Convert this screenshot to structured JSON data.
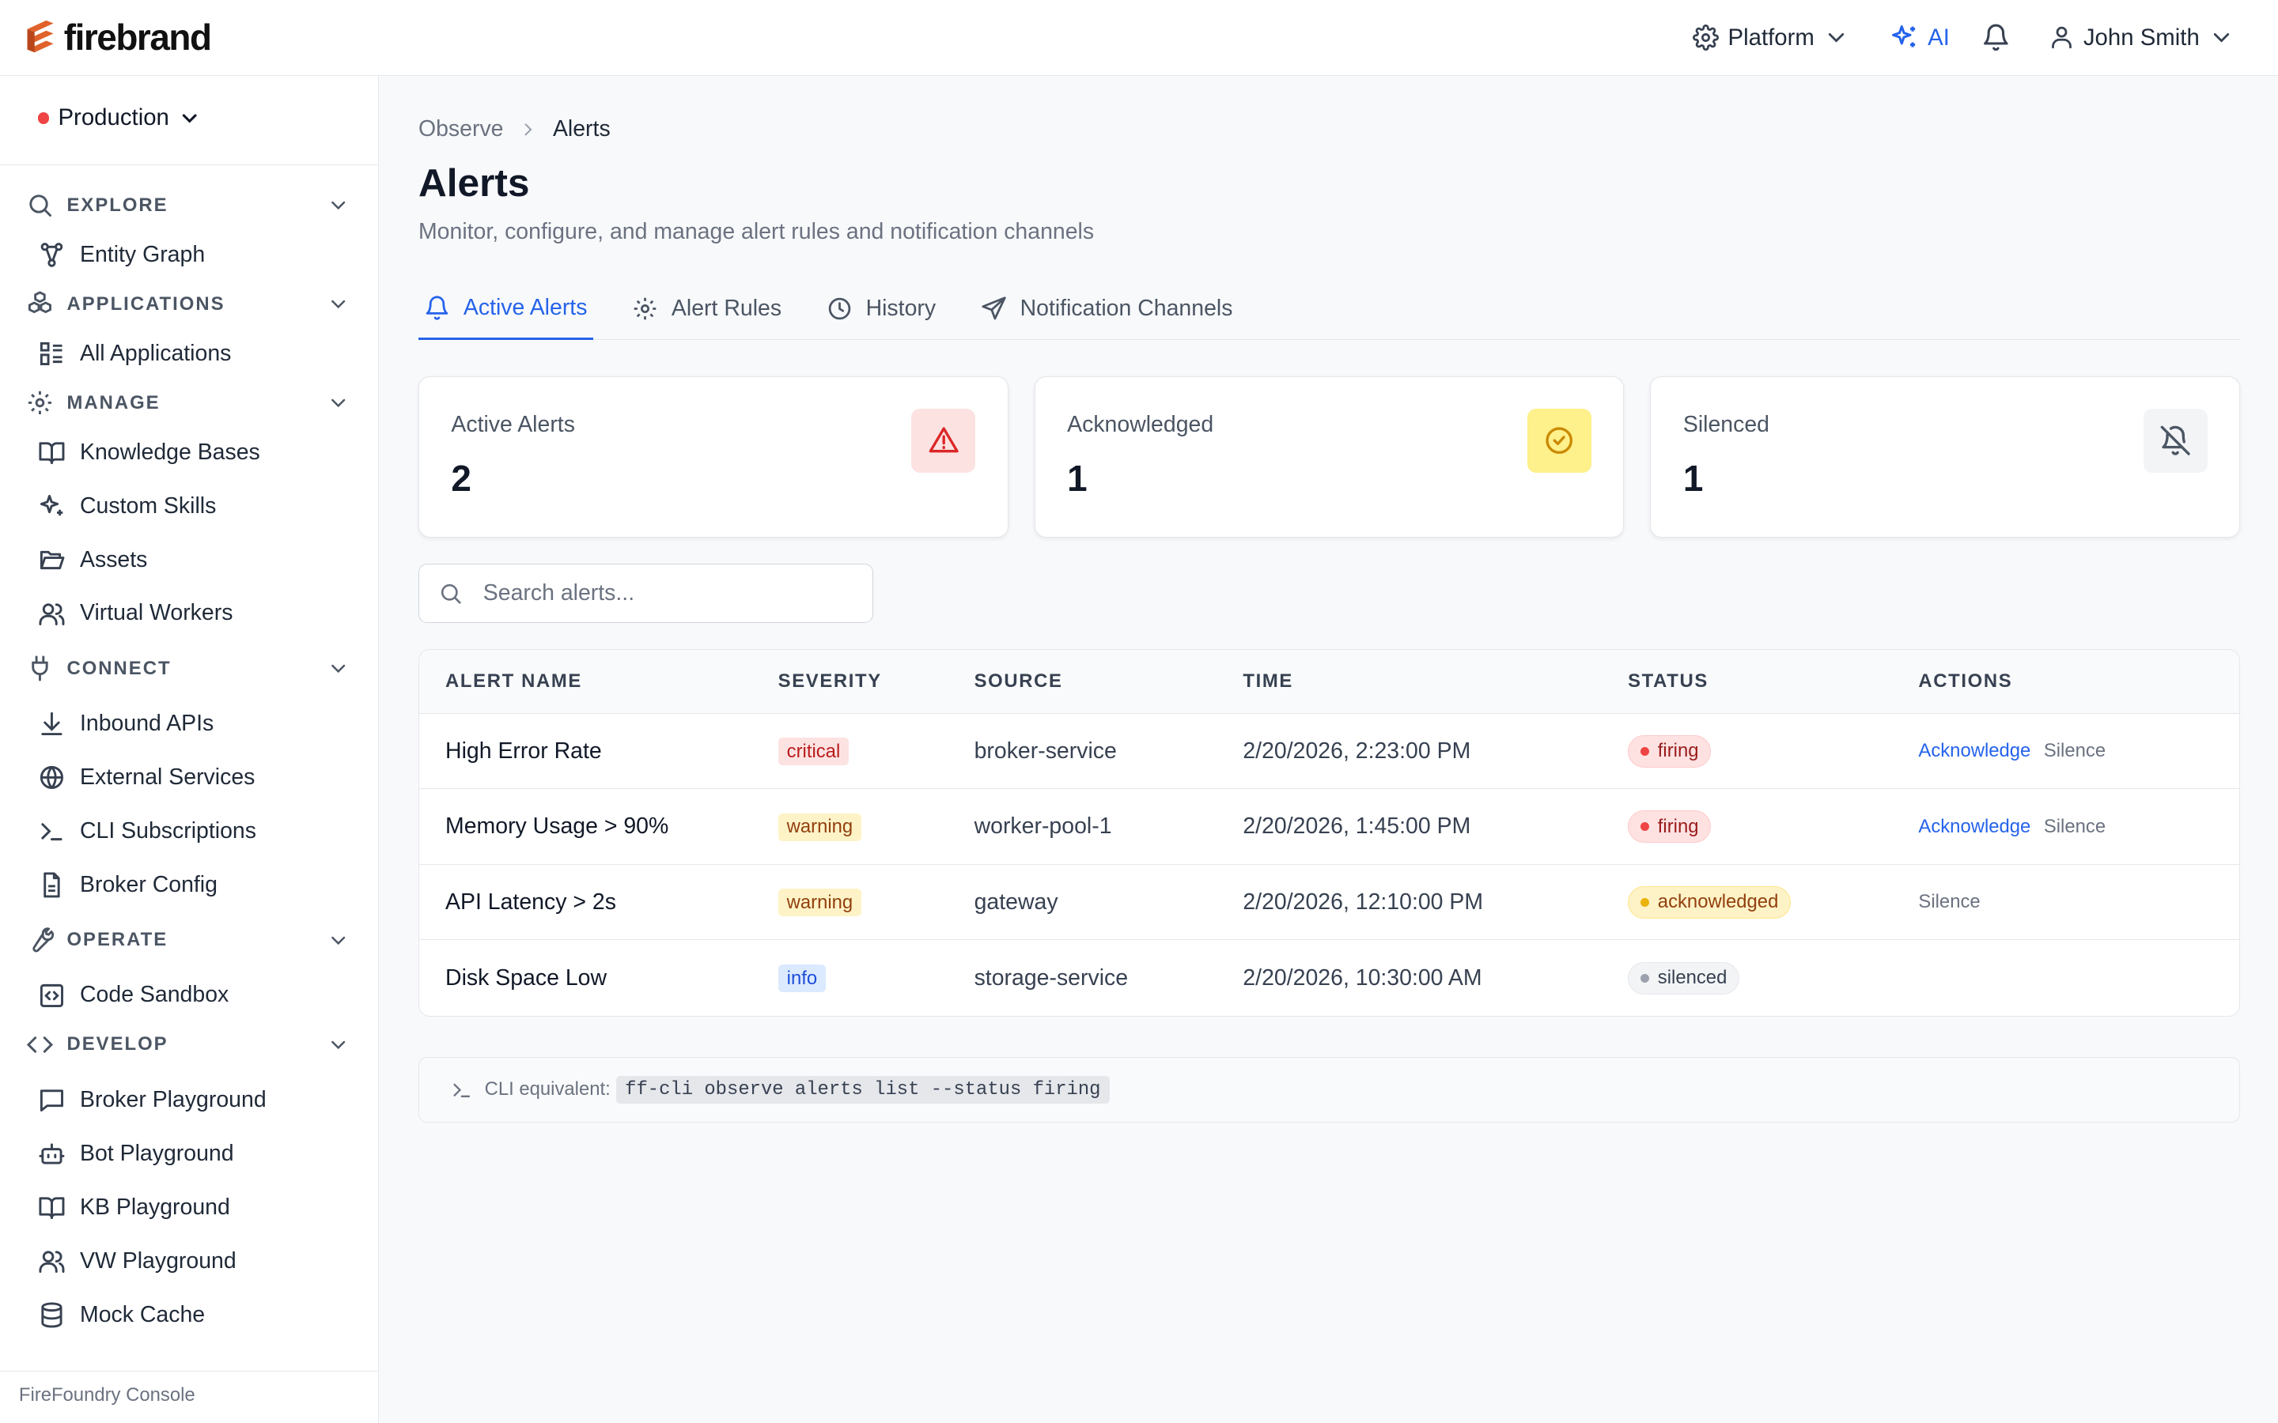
{
  "app": {
    "name": "firebrand",
    "footer": "FireFoundry Console"
  },
  "topbar": {
    "platform": "Platform",
    "ai": "AI",
    "user": "John Smith"
  },
  "environment": {
    "name": "Production"
  },
  "sidebar": {
    "explore": {
      "label": "EXPLORE",
      "items": [
        "Entity Graph"
      ]
    },
    "applications": {
      "label": "APPLICATIONS",
      "items": [
        "All Applications"
      ]
    },
    "manage": {
      "label": "MANAGE",
      "items": [
        "Knowledge Bases",
        "Custom Skills",
        "Assets",
        "Virtual Workers"
      ]
    },
    "connect": {
      "label": "CONNECT",
      "items": [
        "Inbound APIs",
        "External Services",
        "CLI Subscriptions",
        "Broker Config"
      ]
    },
    "operate": {
      "label": "OPERATE",
      "items": [
        "Code Sandbox"
      ]
    },
    "develop": {
      "label": "DEVELOP",
      "items": [
        "Broker Playground",
        "Bot Playground",
        "KB Playground",
        "VW Playground",
        "Mock Cache"
      ]
    }
  },
  "breadcrumb": {
    "parent": "Observe",
    "current": "Alerts"
  },
  "page": {
    "title": "Alerts",
    "subtitle": "Monitor, configure, and manage alert rules and notification channels"
  },
  "tabs": [
    "Active Alerts",
    "Alert Rules",
    "History",
    "Notification Channels"
  ],
  "cards": [
    {
      "title": "Active Alerts",
      "value": "2"
    },
    {
      "title": "Acknowledged",
      "value": "1"
    },
    {
      "title": "Silenced",
      "value": "1"
    }
  ],
  "search": {
    "placeholder": "Search alerts..."
  },
  "table": {
    "headers": [
      "ALERT NAME",
      "SEVERITY",
      "SOURCE",
      "TIME",
      "STATUS",
      "ACTIONS"
    ],
    "rows": [
      {
        "name": "High Error Rate",
        "severity": "critical",
        "source": "broker-service",
        "time": "2/20/2026, 2:23:00 PM",
        "status": "firing",
        "actions": [
          "Acknowledge",
          "Silence"
        ]
      },
      {
        "name": "Memory Usage > 90%",
        "severity": "warning",
        "source": "worker-pool-1",
        "time": "2/20/2026, 1:45:00 PM",
        "status": "firing",
        "actions": [
          "Acknowledge",
          "Silence"
        ]
      },
      {
        "name": "API Latency > 2s",
        "severity": "warning",
        "source": "gateway",
        "time": "2/20/2026, 12:10:00 PM",
        "status": "acknowledged",
        "actions": [
          "Silence"
        ]
      },
      {
        "name": "Disk Space Low",
        "severity": "info",
        "source": "storage-service",
        "time": "2/20/2026, 10:30:00 AM",
        "status": "silenced",
        "actions": []
      }
    ]
  },
  "cli": {
    "label": "CLI equivalent:",
    "command": "ff-cli observe alerts list --status firing"
  },
  "colors": {
    "accent": "#2563eb",
    "brand": "#e0622a",
    "critical": "#dc2626",
    "warning": "#ca8a04"
  }
}
